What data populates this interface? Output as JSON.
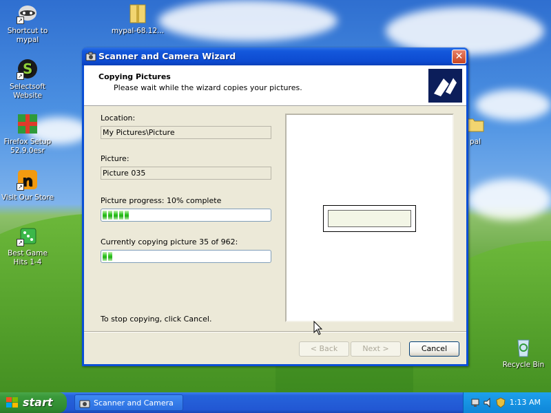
{
  "desktop": {
    "icons": [
      {
        "label": "Shortcut to mypal",
        "icon": "mypal-raccoon-icon"
      },
      {
        "label": "mypal-68.12...",
        "icon": "zip-folder-icon"
      },
      {
        "label": "Selectsoft Website",
        "icon": "selectsoft-icon"
      },
      {
        "label": "Firefox Setup 52.9.0esr",
        "icon": "installer-icon"
      },
      {
        "label": "Visit Our Store",
        "icon": "store-icon"
      },
      {
        "label": "Best Game Hits 1-4",
        "icon": "game-dice-icon"
      },
      {
        "label": "Recycle Bin",
        "icon": "recycle-bin-icon"
      },
      {
        "label": "pal",
        "icon": "folder-icon"
      }
    ]
  },
  "window": {
    "title": "Scanner and Camera Wizard",
    "header_title": "Copying Pictures",
    "header_subtitle": "Please wait while the wizard copies your pictures.",
    "location_label": "Location:",
    "location_value": "My Pictures\\Picture",
    "picture_label": "Picture:",
    "picture_value": "Picture 035",
    "picture_progress_label": "Picture progress: 10% complete",
    "picture_progress_fraction": 0.1,
    "overall_progress_label": "Currently copying picture 35 of 962:",
    "overall_progress_fraction": 0.036,
    "stop_text": "To stop copying, click Cancel.",
    "back_label": "< Back",
    "next_label": "Next >",
    "cancel_label": "Cancel",
    "close_label": "✕"
  },
  "taskbar": {
    "start_label": "start",
    "task_label": "Scanner and Camera ...",
    "clock": "1:13 AM"
  },
  "colors": {
    "titlebar": "#0c4ad0",
    "progress_green": "#22b014",
    "taskbar": "#2257d3",
    "start_green": "#3b9a3b"
  }
}
